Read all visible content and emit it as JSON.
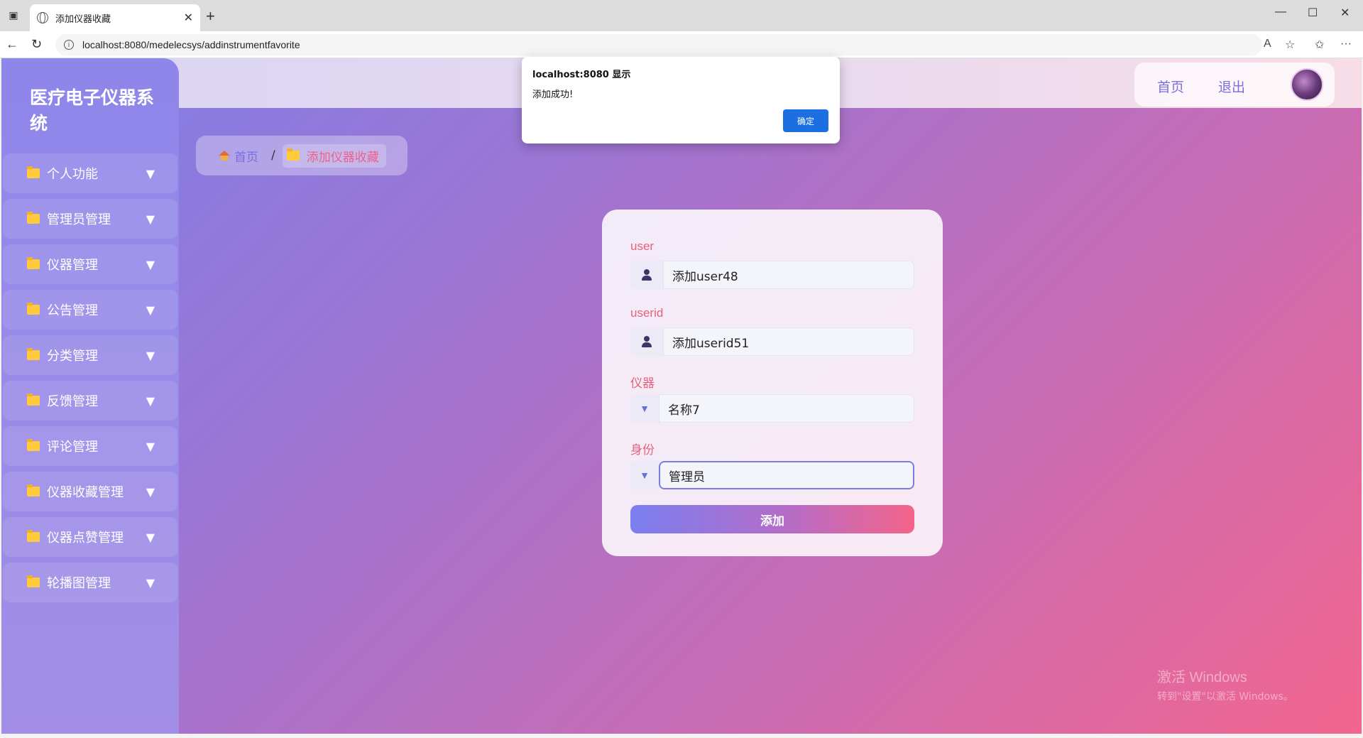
{
  "browser": {
    "tab_title": "添加仪器收藏",
    "url": "localhost:8080/medelecsys/addinstrumentfavorite",
    "icons": [
      "sidebar-toggle-icon",
      "globe-icon",
      "close-icon",
      "new-tab-icon",
      "minimize-icon",
      "maximize-icon",
      "window-close-icon",
      "back-icon",
      "refresh-icon",
      "info-icon",
      "read-aloud-icon",
      "favorite-star-icon",
      "favorites-icon",
      "more-icon"
    ]
  },
  "header": {
    "home_link": "首页",
    "logout_link": "退出"
  },
  "sidebar": {
    "brand": "医疗电子仪器系统",
    "items": [
      {
        "label": "个人功能"
      },
      {
        "label": "管理员管理"
      },
      {
        "label": "仪器管理"
      },
      {
        "label": "公告管理"
      },
      {
        "label": "分类管理"
      },
      {
        "label": "反馈管理"
      },
      {
        "label": "评论管理"
      },
      {
        "label": "仪器收藏管理"
      },
      {
        "label": "仪器点赞管理"
      },
      {
        "label": "轮播图管理"
      }
    ],
    "caret": "▼"
  },
  "breadcrumb": {
    "home": "首页",
    "separator": "/",
    "current": "添加仪器收藏"
  },
  "form": {
    "fields": [
      {
        "label": "user",
        "value": "添加user48"
      },
      {
        "label": "userid",
        "value": "添加userid51"
      },
      {
        "label": "仪器",
        "value": "名称7"
      },
      {
        "label": "身份",
        "value": "管理员"
      }
    ],
    "select_caret": "▼",
    "submit_label": "添加"
  },
  "dialog": {
    "title": "localhost:8080 显示",
    "message": "添加成功!",
    "ok_label": "确定"
  },
  "watermark": {
    "line1": "激活 Windows",
    "line2": "转到\"设置\"以激活 Windows。"
  },
  "colors": {
    "accent": "#7b6fe0",
    "label_pink": "#e8607d",
    "dialog_button": "#1b6fe0"
  }
}
